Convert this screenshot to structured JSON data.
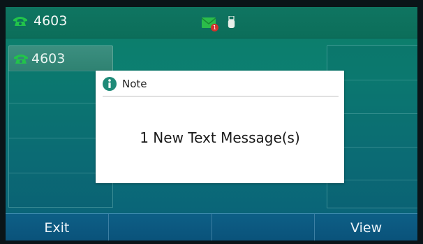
{
  "status_bar": {
    "account_label": "4603",
    "message_badge_count": "1",
    "icons": [
      "phone-handset-icon",
      "envelope-icon",
      "usb-icon"
    ],
    "colors": {
      "phone_green": "#22c44a",
      "envelope_green": "#2bbd4a",
      "badge_red": "#d3302b"
    }
  },
  "line_keys": [
    {
      "label": "4603",
      "icon": "phone-handset-icon"
    }
  ],
  "dialog": {
    "title": "Note",
    "icon": "info-icon",
    "message": "1 New Text Message(s)"
  },
  "softkeys": [
    "Exit",
    "",
    "",
    "View"
  ]
}
